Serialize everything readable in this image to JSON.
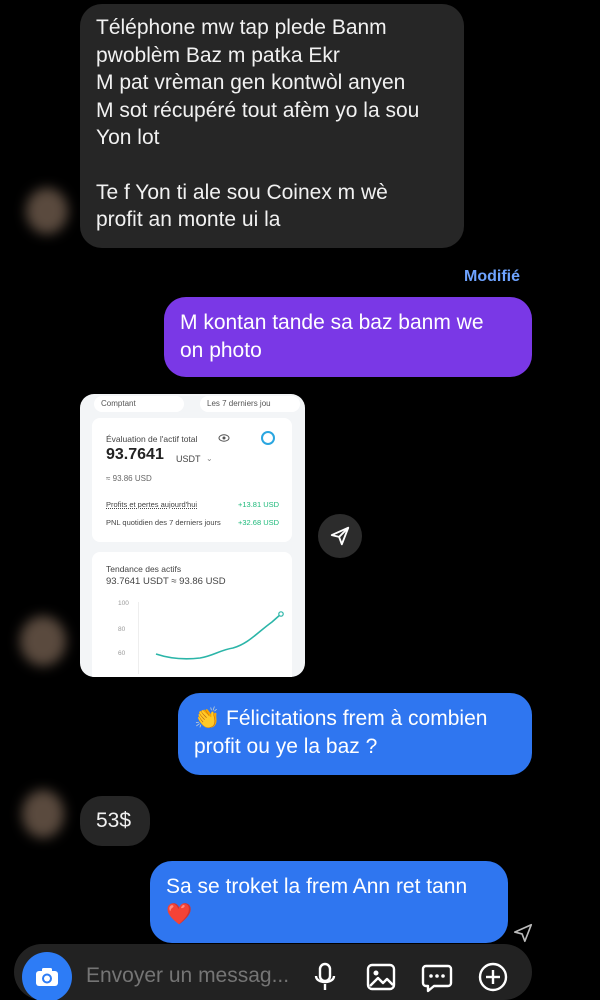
{
  "messages": {
    "incoming_1": {
      "lines_a": [
        "Téléphone mw tap plede Banm",
        "pwoblèm Baz m patka Ekr",
        "M pat vrèman gen kontwòl anyen",
        "M sot récupéré tout afèm yo la sou",
        "Yon lot"
      ],
      "lines_b": [
        "Te f Yon ti ale sou Coinex m wè",
        "profit an monte ui la"
      ]
    },
    "edited_label": "Modifié",
    "outgoing_1": {
      "lines": [
        "M kontan tande sa baz  banm we",
        "on photo"
      ]
    },
    "outgoing_2": {
      "emoji": "👏",
      "lines": [
        "Félicitations frem à combien",
        "profit ou ye la baz ?"
      ]
    },
    "incoming_2": {
      "text": "53$"
    },
    "outgoing_3": {
      "lines": [
        "Sa se troket la frem Ann ret tann"
      ],
      "emoji": "❤️"
    }
  },
  "shared_screenshot": {
    "tab_left": "Comptant",
    "tab_right": "Les 7 derniers jou",
    "eval_label": "Évaluation de l'actif total",
    "balance": "93.7641",
    "currency": "USDT",
    "usd_equiv": "≈ 93.86 USD",
    "pnl_today_label": "Profits et pertes aujourd'hui",
    "pnl_today_value": "+13.81 USD",
    "pnl_7d_label": "PNL quotidien des 7 derniers jours",
    "pnl_7d_value": "+32.68 USD",
    "trend_title": "Tendance des actifs",
    "trend_value": "93.7641 USDT ≈ 93.86 USD",
    "y_ticks": [
      "100",
      "80",
      "60"
    ]
  },
  "composer": {
    "placeholder": "Envoyer un messag..."
  },
  "icons": {
    "camera": "camera-icon",
    "mic": "microphone-icon",
    "gallery": "gallery-icon",
    "sticker": "chat-sticker-icon",
    "plus": "add-circle-icon",
    "share": "send-icon"
  },
  "colors": {
    "incoming_bubble": "#262626",
    "purple_bubble": "#7a38e6",
    "blue_bubble": "#2f76f0",
    "accent": "#2d7cf6",
    "edited": "#6ea3ff"
  }
}
